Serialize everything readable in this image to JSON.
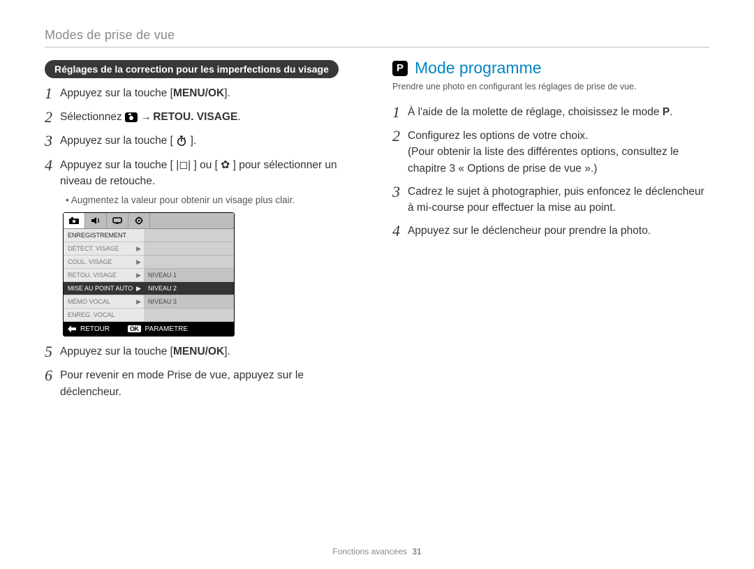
{
  "header": "Modes de prise de vue",
  "left": {
    "pill": "Réglages de la correction pour les imperfections du visage",
    "step1_a": "Appuyez sur la touche [",
    "step1_b": "MENU/OK",
    "step1_c": "].",
    "step2_a": "Sélectionnez ",
    "step2_b": " → ",
    "step2_c": "RETOU. VISAGE",
    "step2_d": ".",
    "step3_a": "Appuyez sur la touche [",
    "step3_b": "].",
    "step4": "Appuyez sur la touche [ |◻| ] ou [ ✿ ] pour sélectionner un niveau de retouche.",
    "bullet": "Augmentez la valeur pour obtenir un visage plus clair.",
    "step5_a": "Appuyez sur la touche [",
    "step5_b": "MENU/OK",
    "step5_c": "].",
    "step6": "Pour revenir en mode Prise de vue, appuyez sur le déclencheur."
  },
  "lcd": {
    "menu": [
      "ENREGISTREMENT",
      "DÉTECT. VISAGE",
      "COUL. VISAGE",
      "RETOU. VISAGE",
      "MISE AU POINT AUTO",
      "MÉMO VOCAL",
      "ENREG. VOCAL"
    ],
    "menu_selected_index": 4,
    "levels": [
      "NIVEAU 1",
      "NIVEAU 2",
      "NIVEAU 3"
    ],
    "level_selected_index": 1,
    "back": "RETOUR",
    "ok": "OK",
    "set": "PARAMETRE"
  },
  "right": {
    "title": "Mode programme",
    "sub": "Prendre une photo en configurant les réglages de prise de vue.",
    "step1_a": "À l'aide de la molette de réglage, choisissez le mode ",
    "step1_b": ".",
    "step2": "Configurez les options de votre choix.\n(Pour obtenir la liste des différentes options, consultez le chapitre 3 « Options de prise de vue ».)",
    "step3": "Cadrez le sujet à photographier, puis enfoncez le déclencheur à mi-course pour effectuer la mise au point.",
    "step4": "Appuyez sur le déclencheur pour prendre la photo."
  },
  "footer": {
    "section": "Fonctions avancées",
    "page": "31"
  }
}
